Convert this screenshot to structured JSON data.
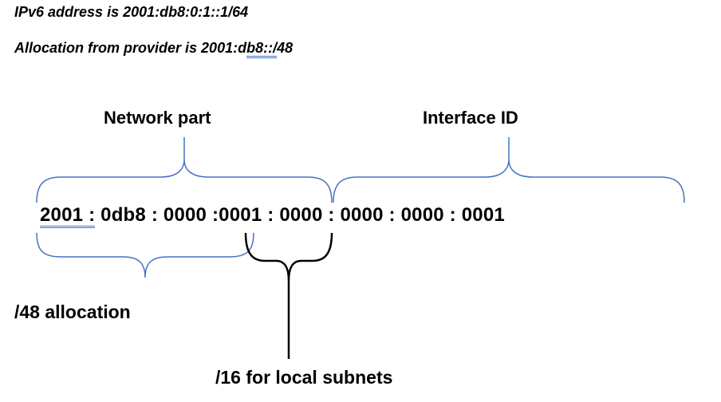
{
  "intro": {
    "line1_prefix": "IPv6 address is ",
    "line1_value": "2001:db8:0:1::1/64",
    "line2_prefix": "Allocation from provider is ",
    "line2_before": "2001:d",
    "line2_underlined": "b8::/",
    "line2_after": "48"
  },
  "labels": {
    "network_part": "Network part",
    "interface_id": "Interface ID",
    "alloc48": "/48 allocation",
    "subnet16": "/16 for local subnets"
  },
  "address": {
    "g1": "2001",
    "g2": "0db8",
    "g3": "0000",
    "g4": "0001",
    "g5": "0000",
    "g6": "0000",
    "g7": "0000",
    "g8": "0001"
  },
  "colors": {
    "brace_blue": "#4472c4",
    "brace_black": "#000000"
  }
}
